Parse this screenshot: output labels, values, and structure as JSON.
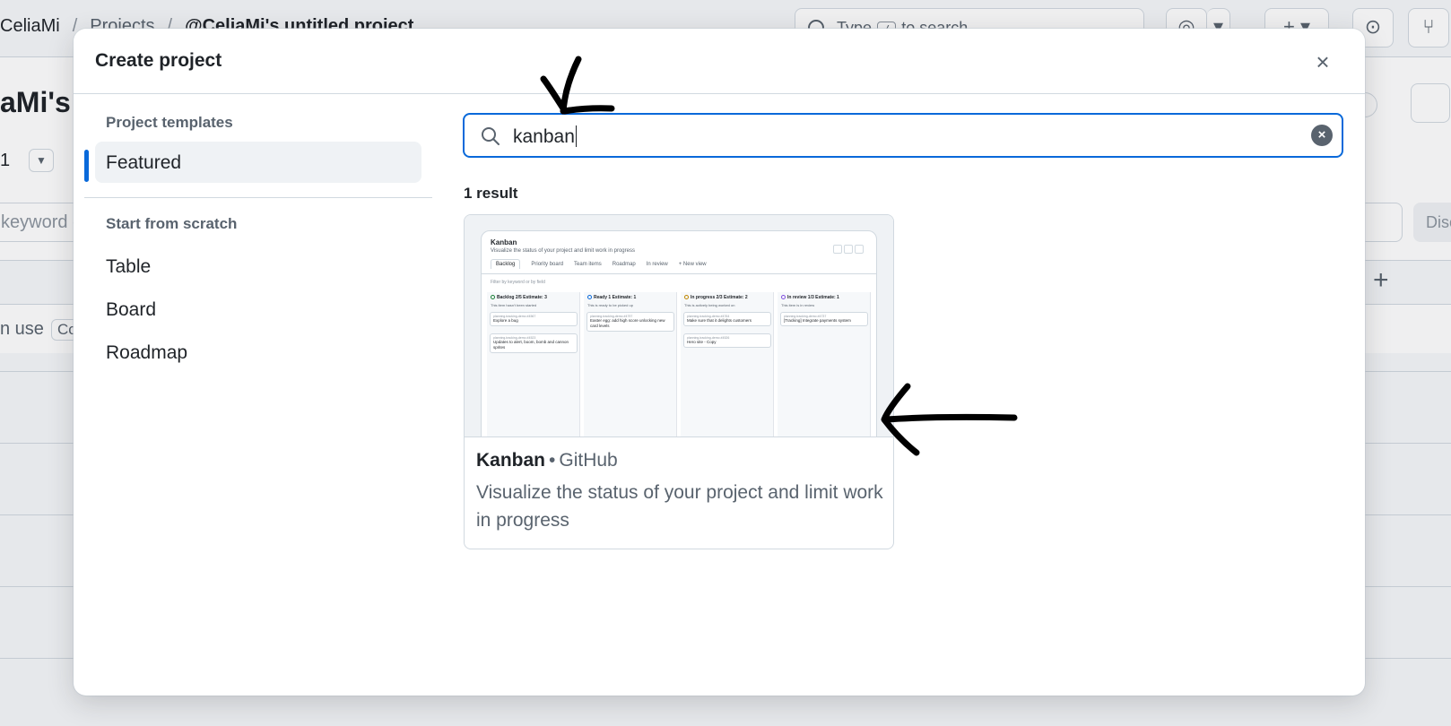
{
  "background": {
    "breadcrumb": [
      "CeliaMi",
      "Projects",
      "@CeliaMi's untitled project"
    ],
    "search_placeholder_before": "Type",
    "search_key": "/",
    "search_placeholder_after": "to search",
    "project_title_fragment": "aMi's u",
    "count": "1",
    "filter_placeholder": "keyword o",
    "discard_label": "Disc",
    "in_use_text": "n use",
    "in_use_tag": "Cor"
  },
  "dialog": {
    "title": "Create project",
    "close_label": "×",
    "sidebar": {
      "templates_heading": "Project templates",
      "templates": [
        {
          "label": "Featured",
          "active": true
        }
      ],
      "scratch_heading": "Start from scratch",
      "scratch_items": [
        {
          "label": "Table"
        },
        {
          "label": "Board"
        },
        {
          "label": "Roadmap"
        }
      ]
    },
    "search": {
      "value": "kanban",
      "clear_label": "×"
    },
    "result_count": "1 result",
    "results": [
      {
        "name": "Kanban",
        "owner": "GitHub",
        "separator": "•",
        "description": "Visualize the status of your project and limit work in progress",
        "preview": {
          "title": "Kanban",
          "subtitle": "Visualize the status of your project and limit work in progress",
          "tabs": [
            "Backlog",
            "Priority board",
            "Team items",
            "Roadmap",
            "In review",
            "+ New view"
          ],
          "filter": "Filter by keyword or by field",
          "columns": [
            {
              "name": "Backlog",
              "count": "2/5",
              "estimate": "Estimate: 3",
              "desc": "This item hasn't been started",
              "ring": "#1a7f37",
              "cards": [
                {
                  "meta": "planning-tracking-demo #4567",
                  "title": "Explore a bug"
                },
                {
                  "meta": "planning-tracking-demo #4523",
                  "title": "Updates to alert, boom, bomb and cannon sprites"
                }
              ]
            },
            {
              "name": "Ready",
              "count": "1",
              "estimate": "Estimate: 1",
              "desc": "This is ready to be picked up",
              "ring": "#0969da",
              "cards": [
                {
                  "meta": "planning-tracking-demo #4797",
                  "title": "Easter egg: add high score unlocking new card levels"
                }
              ]
            },
            {
              "name": "In progress",
              "count": "2/3",
              "estimate": "Estimate: 2",
              "desc": "This is actively being worked on",
              "ring": "#bf8700",
              "cards": [
                {
                  "meta": "planning-tracking-demo #4764",
                  "title": "Make sure that it delights customers"
                },
                {
                  "meta": "planning-tracking-demo #4526",
                  "title": "Hero site - Copy"
                }
              ]
            },
            {
              "name": "In review",
              "count": "1/3",
              "estimate": "Estimate: 1",
              "desc": "This item is in review",
              "ring": "#8250df",
              "cards": [
                {
                  "meta": "planning-tracking-demo #4737",
                  "title": "[Tracking] Integrate payments system"
                }
              ]
            }
          ]
        }
      }
    ]
  },
  "colors": {
    "accent": "#0969da",
    "annotation": "#000000"
  }
}
